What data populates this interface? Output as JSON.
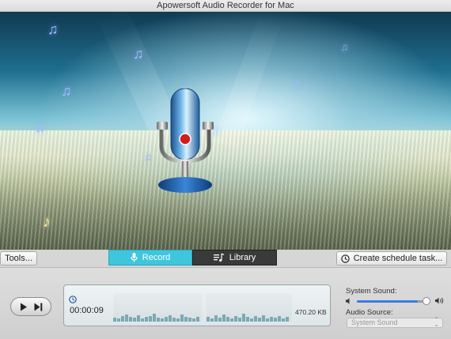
{
  "window": {
    "title": "Apowersoft Audio Recorder for Mac"
  },
  "toolbar": {
    "tools_label": "Tools...",
    "tabs": [
      {
        "label": "Record",
        "icon": "microphone-icon",
        "active": true
      },
      {
        "label": "Library",
        "icon": "music-list-icon",
        "active": false
      }
    ],
    "schedule_label": "Create schedule task...",
    "schedule_icon": "clock-icon"
  },
  "player": {
    "play_icon": "play-icon",
    "next_icon": "skip-next-icon",
    "timer_icon": "clock-icon",
    "elapsed_time": "00:00:09",
    "file_size": "470.20 KB"
  },
  "sound": {
    "system_sound_label": "System Sound:",
    "volume_level": 0.87,
    "audio_source_label": "Audio Source:",
    "audio_source_value": "System Sound"
  },
  "colors": {
    "active_tab": "#3ec6dc",
    "inactive_tab": "#3a3a3a",
    "accent": "#3a7de0",
    "waveform": "#7aa9b5"
  }
}
